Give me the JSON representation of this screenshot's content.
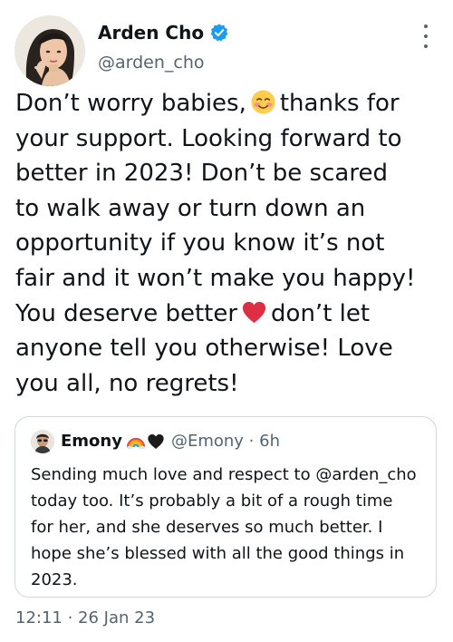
{
  "author": {
    "name": "Arden Cho",
    "handle": "@arden_cho",
    "verified": true
  },
  "tweet": {
    "lines": [
      {
        "text": "Don’t worry babies,",
        "emoji": "smiling-face-with-hearts-blush",
        "after": "thanks for"
      },
      {
        "text": "your support. Looking forward to"
      },
      {
        "text": "better in 2023! Don’t be scared"
      },
      {
        "text": "to walk away or turn down an"
      },
      {
        "text": "opportunity if you know it’s not"
      },
      {
        "text": "fair and it won’t make you happy!"
      },
      {
        "text": "You deserve better",
        "emoji": "red-heart",
        "after": "don’t let"
      },
      {
        "text": "anyone tell you otherwise! Love"
      },
      {
        "text": "you all, no regrets!"
      }
    ]
  },
  "quoted_tweet": {
    "name": "Emony",
    "emojis": [
      "rainbow",
      "black-heart"
    ],
    "handle_time": "@Emony · 6h",
    "lines": [
      "Sending much love and respect to @arden_cho",
      "today too. It’s probably a bit of a rough time",
      "for her, and she deserves so much better. I",
      "hope she’s blessed with all the good things in",
      "2023."
    ]
  },
  "timestamp": "12:11 · 26 Jan 23",
  "colors": {
    "text": "#0f1419",
    "secondary": "#536471",
    "verified_blue": "#1d9bf0",
    "border": "#cfd9de"
  }
}
